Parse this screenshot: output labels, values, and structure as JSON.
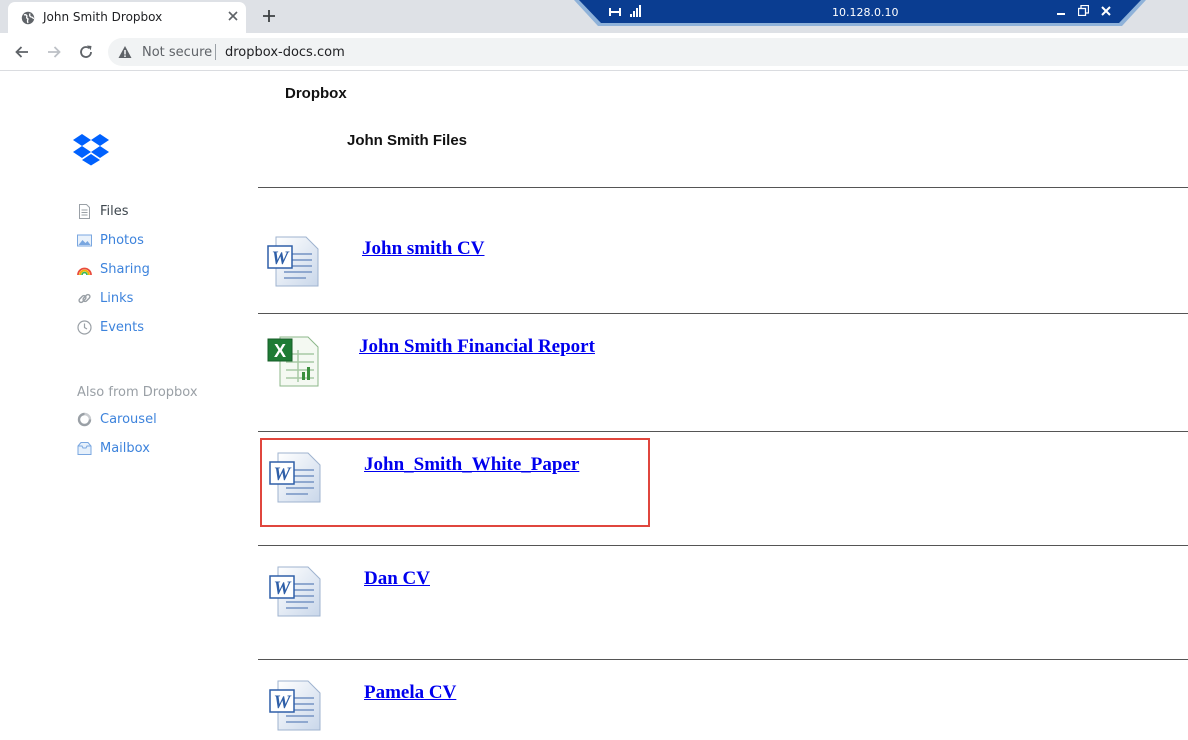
{
  "browser": {
    "tab_title": "John Smith Dropbox",
    "security_label": "Not secure",
    "url": "dropbox-docs.com",
    "remote_session_ip": "10.128.0.10"
  },
  "page": {
    "brand": "Dropbox",
    "owner_title": "John Smith Files"
  },
  "sidebar": {
    "items": [
      {
        "label": "Files",
        "icon": "file-icon",
        "active": true
      },
      {
        "label": "Photos",
        "icon": "photo-icon"
      },
      {
        "label": "Sharing",
        "icon": "rainbow-icon"
      },
      {
        "label": "Links",
        "icon": "link-icon"
      },
      {
        "label": "Events",
        "icon": "clock-icon"
      }
    ],
    "also_label": "Also from Dropbox",
    "also_items": [
      {
        "label": "Carousel",
        "icon": "carousel-icon"
      },
      {
        "label": "Mailbox",
        "icon": "mailbox-icon"
      }
    ]
  },
  "files": [
    {
      "name": "John smith CV ",
      "type": "word"
    },
    {
      "name": "John Smith Financial Report",
      "type": "excel"
    },
    {
      "name": "John_Smith_White_Paper",
      "type": "word",
      "highlighted": true
    },
    {
      "name": "Dan CV",
      "type": "word"
    },
    {
      "name": "Pamela CV",
      "type": "word"
    }
  ],
  "colors": {
    "link": "#0000ee",
    "sidebar_link": "#3d83dc",
    "dropbox_blue": "#0061fe",
    "highlight_border": "#e0463d",
    "remote_bar": "#0a3d91"
  }
}
